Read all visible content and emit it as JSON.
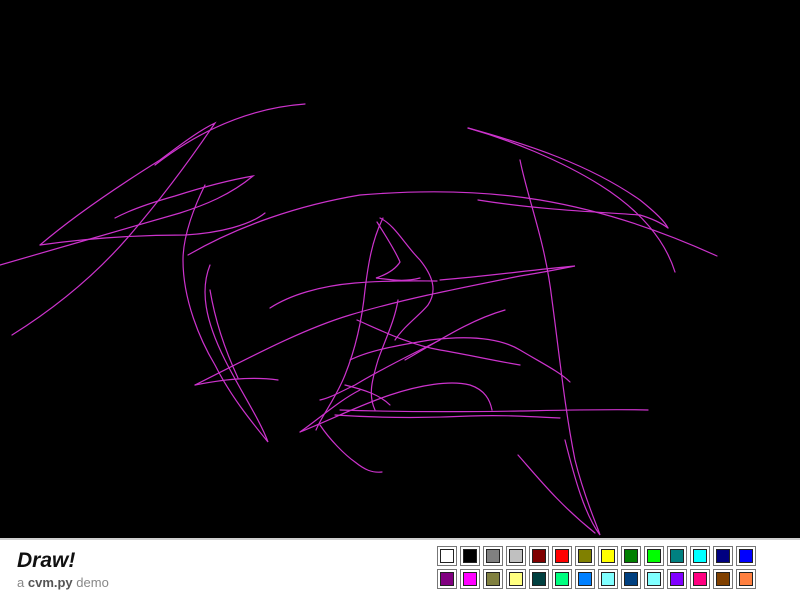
{
  "app": {
    "title": "Draw!",
    "subtitle_prefix": "a",
    "subtitle_brand": "cvm.py",
    "subtitle_suffix": "demo"
  },
  "canvas": {
    "background": "#000000",
    "stroke_color": "#cc33cc"
  },
  "palette": {
    "rows": [
      [
        "#ffffff",
        "#000000",
        "#808080",
        "#c0c0c0",
        "#800000",
        "#ff0000",
        "#808000",
        "#ffff00",
        "#008000",
        "#00ff00",
        "#008080",
        "#00ffff",
        "#000080",
        "#0000ff"
      ],
      [
        "#800080",
        "#ff00ff",
        "#808040",
        "#ffff80",
        "#004040",
        "#00ff80",
        "#0080ff",
        "#80ffff",
        "#004080",
        "#80ffff",
        "#8000ff",
        "#ff0080",
        "#804000",
        "#ff8040"
      ]
    ]
  }
}
